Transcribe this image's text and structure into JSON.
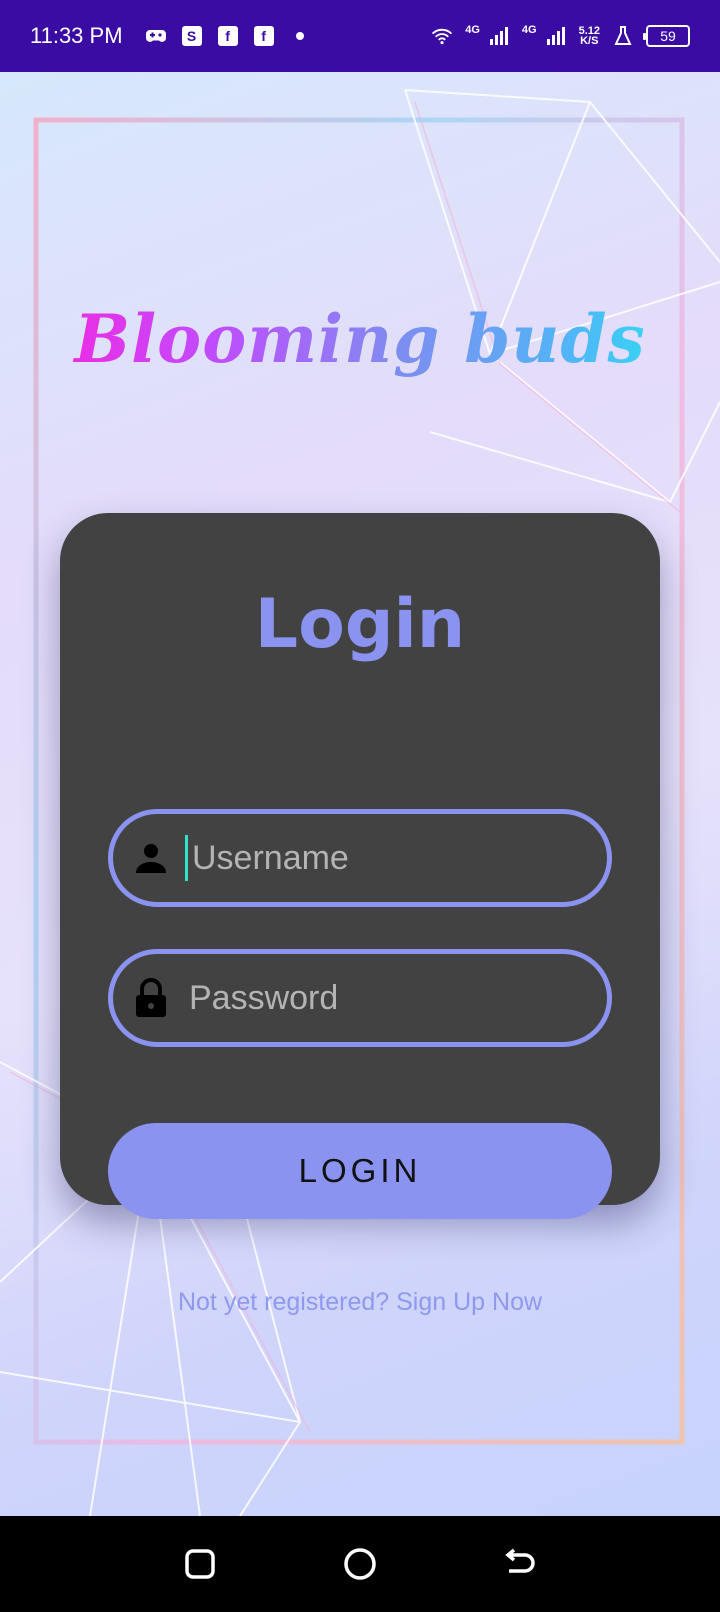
{
  "status_bar": {
    "time": "11:33 PM",
    "network_1": "4G",
    "network_2": "4G",
    "speed_value": "5.12",
    "speed_unit": "K/S",
    "battery": "59",
    "left_icons": [
      "gamepad-icon",
      "shopping-bag-icon",
      "facebook-icon",
      "facebook-icon",
      "notification-dot-icon"
    ]
  },
  "app": {
    "title": "Blooming buds"
  },
  "login_card": {
    "title": "Login",
    "username_placeholder": "Username",
    "password_placeholder": "Password",
    "login_button": "LOGIN"
  },
  "signup_link": "Not yet registered? Sign Up Now",
  "colors": {
    "status_bar": "#3a0ca3",
    "card": "#424242",
    "accent": "#8a93f0",
    "cursor": "#2ee3c8"
  }
}
